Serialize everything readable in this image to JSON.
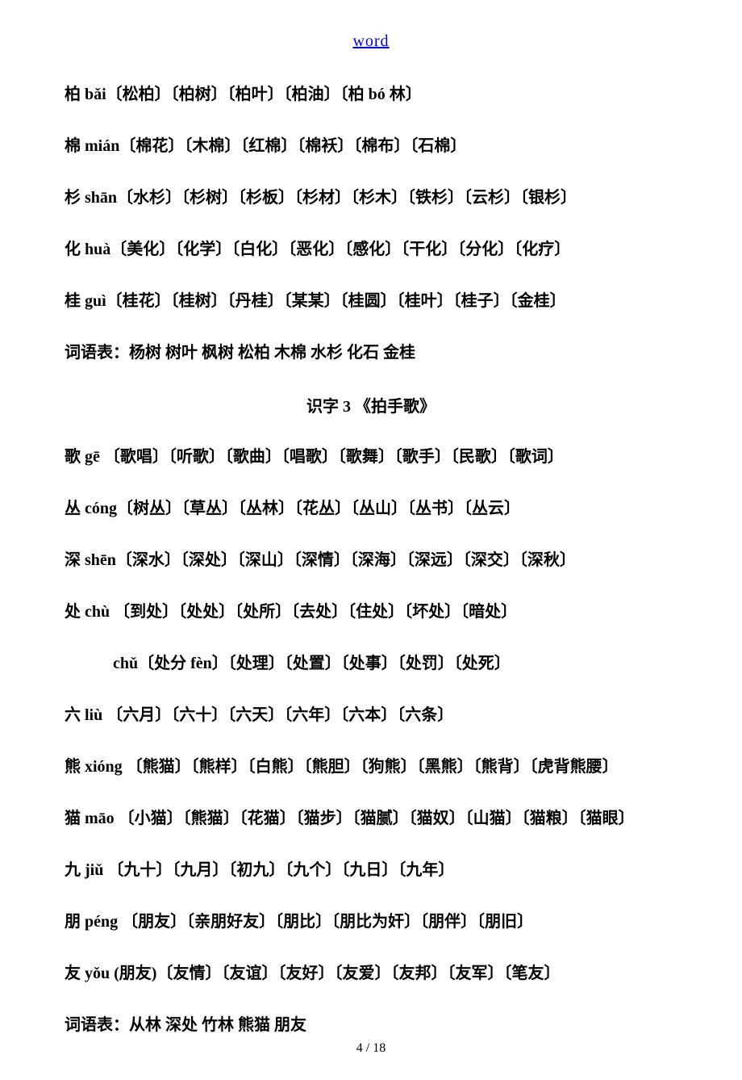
{
  "header": {
    "link": "word"
  },
  "lines": {
    "l1": "柏 bǎi〔松柏〕〔柏树〕〔柏叶〕〔柏油〕〔柏 bó 林〕",
    "l2": "棉 mián〔棉花〕〔木棉〕〔红棉〕〔棉袄〕〔棉布〕〔石棉〕",
    "l3": "杉 shān〔水杉〕〔杉树〕〔杉板〕〔杉材〕〔杉木〕〔铁杉〕〔云杉〕〔银杉〕",
    "l4": "化 huà〔美化〕〔化学〕〔白化〕〔恶化〕〔感化〕〔干化〕〔分化〕〔化疗〕",
    "l5": "桂 guì〔桂花〕〔桂树〕〔丹桂〕〔某某〕〔桂圆〕〔桂叶〕〔桂子〕〔金桂〕",
    "l6": "词语表：杨树  树叶  枫树  松柏  木棉  水杉  化石  金桂",
    "section": "识字 3 《拍手歌》",
    "l7": "歌 gē  〔歌唱〕〔听歌〕〔歌曲〕〔唱歌〕〔歌舞〕〔歌手〕〔民歌〕〔歌词〕",
    "l8": "丛 cóng〔树丛〕〔草丛〕〔丛林〕〔花丛〕〔丛山〕〔丛书〕〔丛云〕",
    "l9": "深 shēn〔深水〕〔深处〕〔深山〕〔深情〕〔深海〕〔深远〕〔深交〕〔深秋〕",
    "l10": "处  chù 〔到处〕〔处处〕〔处所〕〔去处〕〔住处〕〔坏处〕〔暗处〕",
    "l10b": "chǔ〔处分 fèn〕〔处理〕〔处置〕〔处事〕〔处罚〕〔处死〕",
    "l11": "六 liù 〔六月〕〔六十〕〔六天〕〔六年〕〔六本〕〔六条〕",
    "l12": "熊 xióng 〔熊猫〕〔熊样〕〔白熊〕〔熊胆〕〔狗熊〕〔黑熊〕〔熊背〕〔虎背熊腰〕",
    "l13": "猫 māo 〔小猫〕〔熊猫〕〔花猫〕〔猫步〕〔猫腻〕〔猫奴〕〔山猫〕〔猫粮〕〔猫眼〕",
    "l14": "九 jiǔ 〔九十〕〔九月〕〔初九〕〔九个〕〔九日〕〔九年〕",
    "l15": "朋 péng 〔朋友〕〔亲朋好友〕〔朋比〕〔朋比为奸〕〔朋伴〕〔朋旧〕",
    "l16": "友 yǒu  (朋友)〔友情〕〔友谊〕〔友好〕〔友爱〕〔友邦〕〔友军〕〔笔友〕",
    "l17": "词语表：从林  深处  竹林  熊猫  朋友"
  },
  "footer": {
    "page": "4 / 18"
  }
}
